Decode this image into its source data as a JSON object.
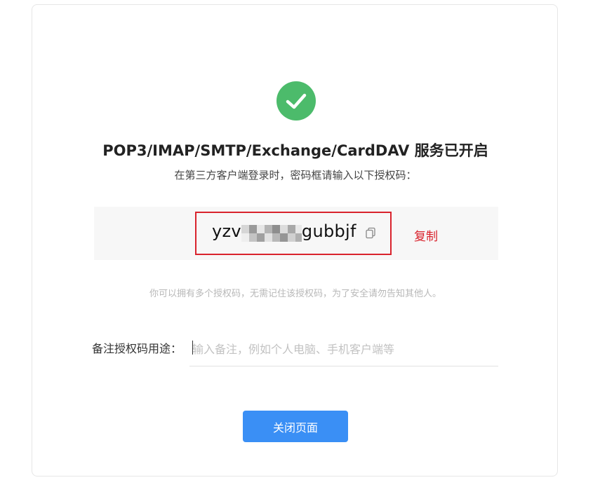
{
  "status": {
    "title": "POP3/IMAP/SMTP/Exchange/CardDAV 服务已开启",
    "subtitle": "在第三方客户端登录时，密码框请输入以下授权码："
  },
  "auth_code": {
    "prefix": "yzv",
    "suffix": "gubbjf",
    "copy_label": "复制"
  },
  "hint": "你可以拥有多个授权码，无需记住该授权码，为了安全请勿告知其他人。",
  "note": {
    "label": "备注授权码用途：",
    "placeholder": "输入备注，例如个人电脑、手机客户端等",
    "value": ""
  },
  "close_button": "关闭页面",
  "colors": {
    "success": "#4cbb6b",
    "highlight_border": "#d9232d",
    "copy_link": "#d9232d",
    "primary_button": "#3a8ff5"
  }
}
